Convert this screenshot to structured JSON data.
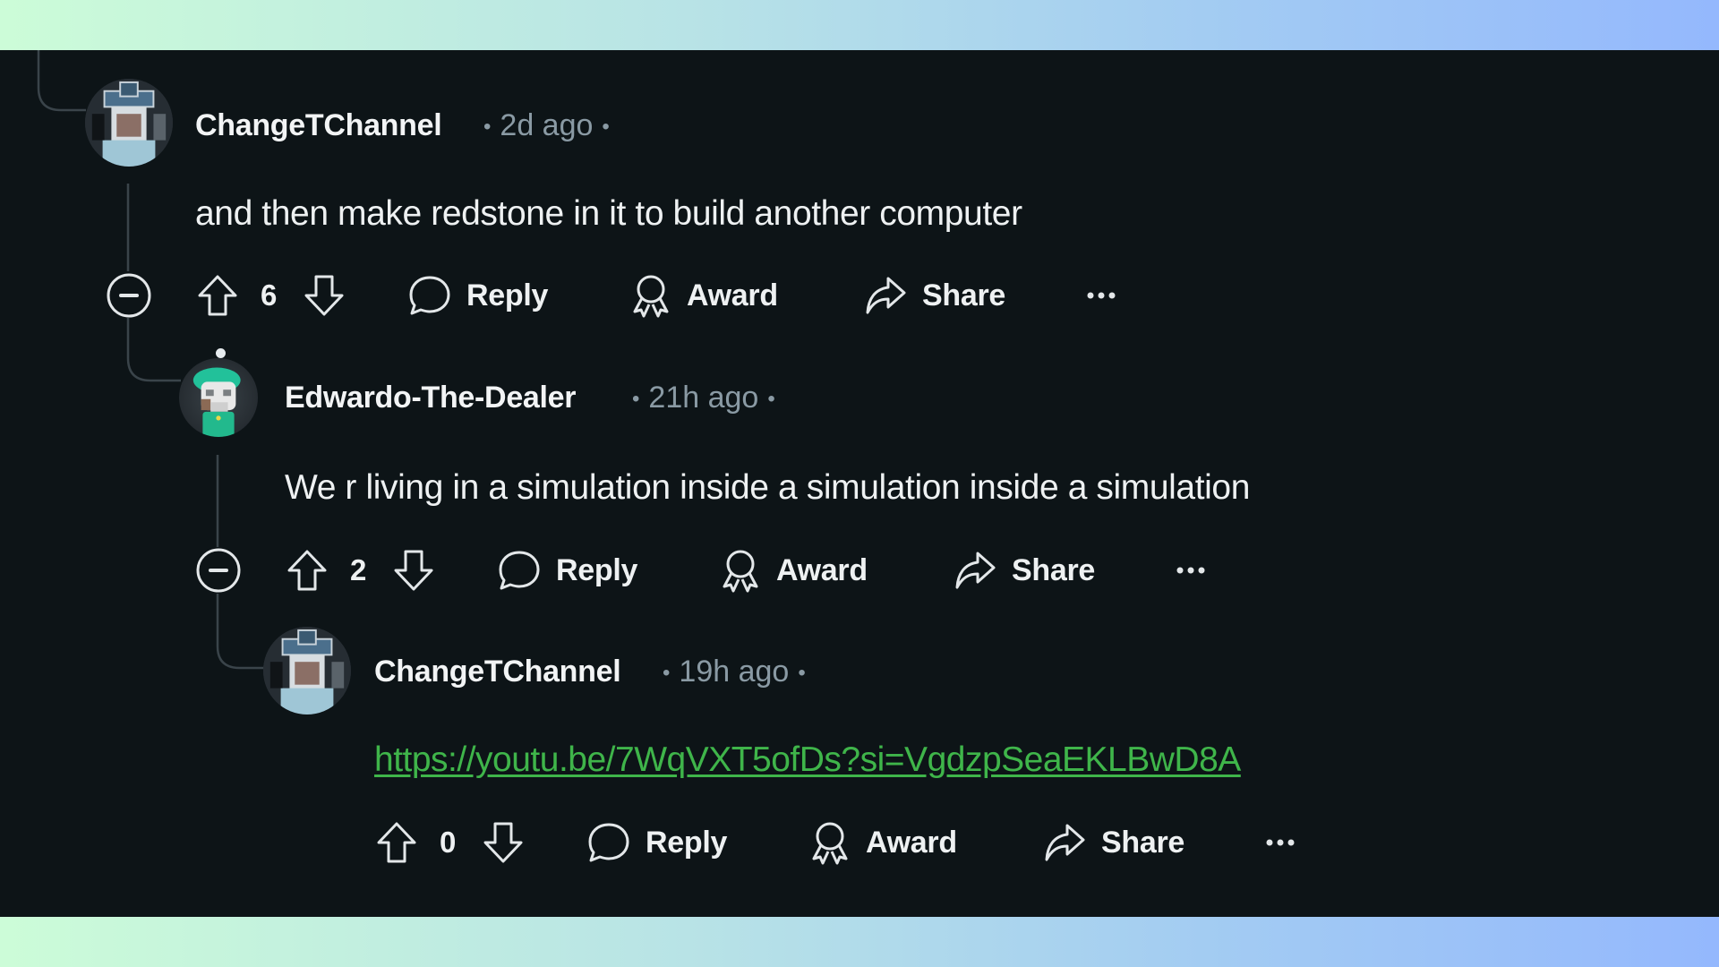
{
  "colors": {
    "panel_bg": "#0d1417",
    "text_primary": "#eef1f2",
    "text_meta": "#8a9aa4",
    "link": "#3fb54a",
    "thread_line": "#3a444a"
  },
  "comments": [
    {
      "username": "ChangeTChannel",
      "timestamp": "2d ago",
      "body": "and then make redstone in it to build another computer",
      "score": "6",
      "avatar_icon": "user-avatar-image",
      "has_collapse": true,
      "actions": {
        "reply": "Reply",
        "award": "Award",
        "share": "Share",
        "more": "more-options-icon"
      }
    },
    {
      "username": "Edwardo-The-Dealer",
      "timestamp": "21h ago",
      "body": "We r living in a simulation inside a simulation inside a simulation",
      "score": "2",
      "avatar_icon": "snoo-avatar-green-cap",
      "online_indicator": true,
      "has_collapse": true,
      "actions": {
        "reply": "Reply",
        "award": "Award",
        "share": "Share",
        "more": "more-options-icon"
      }
    },
    {
      "username": "ChangeTChannel",
      "timestamp": "19h ago",
      "link": "https://youtu.be/7WqVXT5ofDs?si=VgdzpSeaEKLBwD8A",
      "score": "0",
      "avatar_icon": "user-avatar-image",
      "has_collapse": false,
      "actions": {
        "reply": "Reply",
        "award": "Award",
        "share": "Share",
        "more": "more-options-icon"
      }
    }
  ]
}
